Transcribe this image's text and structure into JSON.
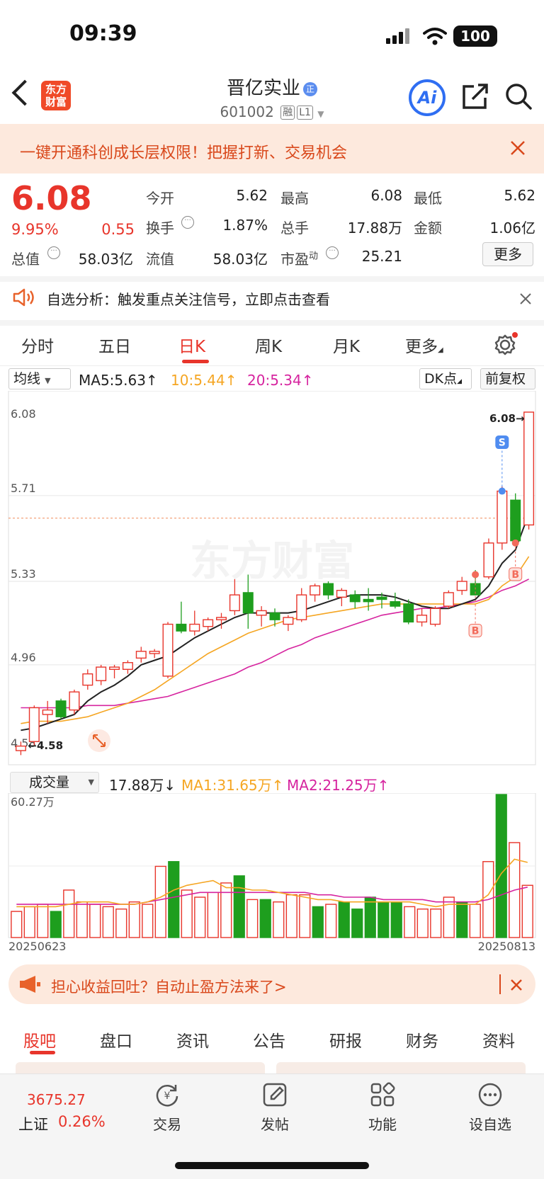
{
  "status_bar": {
    "time": "09:39",
    "battery": "100"
  },
  "header": {
    "logo": "东方财富",
    "title": "晋亿实业",
    "title_badge": "正",
    "code": "601002",
    "tags": [
      "融",
      "L1"
    ]
  },
  "banner": {
    "text": "一键开通科创成长层权限！把握打新、交易机会"
  },
  "quote": {
    "price": "6.08",
    "change_pct": "9.95%",
    "change": "0.55",
    "fields": [
      {
        "label": "今开",
        "value": "5.62",
        "red": true
      },
      {
        "label": "最高",
        "value": "6.08",
        "red": true
      },
      {
        "label": "最低",
        "value": "5.62",
        "red": true
      },
      {
        "label": "换手",
        "value": "1.87%"
      },
      {
        "label": "总手",
        "value": "17.88万"
      },
      {
        "label": "金额",
        "value": "1.06亿"
      },
      {
        "label": "总值",
        "value": "58.03亿"
      },
      {
        "label": "流值",
        "value": "58.03亿"
      },
      {
        "label": "市盈",
        "sup": "动",
        "value": "25.21"
      }
    ],
    "more": "更多"
  },
  "notice": {
    "text": "自选分析：触发重点关注信号，立即点击查看"
  },
  "chart_tabs": [
    "分时",
    "五日",
    "日K",
    "周K",
    "月K",
    "更多"
  ],
  "active_chart_tab": "日K",
  "kline_toolbar": {
    "indicator": "均线",
    "ma5": "MA5:5.63↑",
    "ma10": "10:5.44↑",
    "ma20": "20:5.34↑",
    "dk": "DK点",
    "adjust": "前复权"
  },
  "volume_toolbar": {
    "indicator": "成交量",
    "vol": "17.88万↓",
    "ma1": "MA1:31.65万↑",
    "ma2": "MA2:21.25万↑"
  },
  "colors": {
    "up": "#e8352b",
    "down": "#1e9e1e",
    "ma5": "#222222",
    "ma10": "#f5a623",
    "ma20": "#d6249f"
  },
  "chart_data": {
    "type": "candlestick",
    "price_axis_labels": [
      "6.08",
      "5.71",
      "5.33",
      "4.96",
      "4.58"
    ],
    "ylim": [
      4.58,
      6.08
    ],
    "high_label": "6.08→",
    "low_label": "←4.58",
    "signals": [
      "S",
      "B",
      "B"
    ],
    "date_start": "20250623",
    "date_end": "20250813",
    "volume_max_label": "60.27万",
    "volume_ylim": [
      0,
      60.27
    ],
    "ohlc": [
      [
        4.58,
        4.62,
        4.56,
        4.6
      ],
      [
        4.62,
        4.78,
        4.6,
        4.77
      ],
      [
        4.74,
        4.8,
        4.7,
        4.76
      ],
      [
        4.8,
        4.81,
        4.72,
        4.73
      ],
      [
        4.76,
        4.85,
        4.74,
        4.84
      ],
      [
        4.87,
        4.94,
        4.85,
        4.92
      ],
      [
        4.89,
        4.96,
        4.87,
        4.95
      ],
      [
        4.94,
        4.96,
        4.9,
        4.95
      ],
      [
        4.94,
        4.98,
        4.92,
        4.97
      ],
      [
        4.99,
        5.04,
        4.97,
        5.02
      ],
      [
        5.01,
        5.03,
        4.99,
        5.02
      ],
      [
        4.91,
        5.15,
        4.9,
        5.14
      ],
      [
        5.14,
        5.24,
        5.1,
        5.11
      ],
      [
        5.11,
        5.2,
        5.09,
        5.14
      ],
      [
        5.13,
        5.17,
        5.11,
        5.16
      ],
      [
        5.16,
        5.19,
        5.12,
        5.17
      ],
      [
        5.2,
        5.34,
        5.18,
        5.27
      ],
      [
        5.28,
        5.36,
        5.12,
        5.19
      ],
      [
        5.18,
        5.22,
        5.13,
        5.2
      ],
      [
        5.19,
        5.21,
        5.13,
        5.16
      ],
      [
        5.14,
        5.18,
        5.11,
        5.17
      ],
      [
        5.16,
        5.3,
        5.15,
        5.27
      ],
      [
        5.27,
        5.32,
        5.24,
        5.31
      ],
      [
        5.32,
        5.33,
        5.25,
        5.27
      ],
      [
        5.26,
        5.3,
        5.22,
        5.29
      ],
      [
        5.27,
        5.29,
        5.21,
        5.24
      ],
      [
        5.25,
        5.3,
        5.2,
        5.24
      ],
      [
        5.26,
        5.28,
        5.21,
        5.25
      ],
      [
        5.24,
        5.28,
        5.21,
        5.22
      ],
      [
        5.23,
        5.25,
        5.14,
        5.15
      ],
      [
        5.15,
        5.21,
        5.13,
        5.18
      ],
      [
        5.14,
        5.22,
        5.13,
        5.21
      ],
      [
        5.22,
        5.29,
        5.21,
        5.28
      ],
      [
        5.29,
        5.35,
        5.27,
        5.33
      ],
      [
        5.32,
        5.38,
        5.27,
        5.27
      ],
      [
        5.35,
        5.52,
        5.34,
        5.5
      ],
      [
        5.5,
        5.75,
        5.47,
        5.73
      ],
      [
        5.69,
        5.72,
        5.51,
        5.51
      ],
      [
        5.58,
        6.08,
        5.56,
        6.08
      ]
    ],
    "ma5": [
      4.67,
      4.68,
      4.7,
      4.72,
      4.74,
      4.8,
      4.84,
      4.87,
      4.91,
      4.96,
      4.98,
      5.0,
      5.04,
      5.08,
      5.11,
      5.14,
      5.17,
      5.19,
      5.19,
      5.19,
      5.19,
      5.2,
      5.22,
      5.24,
      5.26,
      5.27,
      5.27,
      5.27,
      5.26,
      5.24,
      5.22,
      5.21,
      5.21,
      5.23,
      5.25,
      5.31,
      5.41,
      5.47,
      5.63
    ],
    "ma10": [
      4.7,
      4.71,
      4.71,
      4.71,
      4.72,
      4.73,
      4.75,
      4.77,
      4.79,
      4.82,
      4.85,
      4.89,
      4.93,
      4.97,
      5.01,
      5.04,
      5.07,
      5.1,
      5.12,
      5.14,
      5.16,
      5.17,
      5.18,
      5.19,
      5.2,
      5.21,
      5.22,
      5.23,
      5.23,
      5.23,
      5.23,
      5.23,
      5.23,
      5.23,
      5.23,
      5.25,
      5.31,
      5.35,
      5.44
    ],
    "ma20": [
      4.77,
      4.77,
      4.77,
      4.77,
      4.77,
      4.78,
      4.78,
      4.78,
      4.79,
      4.8,
      4.81,
      4.82,
      4.84,
      4.86,
      4.88,
      4.9,
      4.92,
      4.95,
      4.97,
      5.0,
      5.03,
      5.05,
      5.08,
      5.1,
      5.12,
      5.14,
      5.16,
      5.18,
      5.19,
      5.2,
      5.21,
      5.21,
      5.22,
      5.23,
      5.24,
      5.26,
      5.29,
      5.31,
      5.34
    ],
    "volume": [
      11,
      13,
      14,
      11,
      20,
      15,
      14,
      13,
      12,
      15,
      14,
      30,
      32,
      20,
      17,
      19,
      23,
      26,
      16,
      16,
      15,
      18,
      18,
      13,
      14,
      15,
      12,
      17,
      15,
      15,
      13,
      12,
      12,
      17,
      15,
      14,
      32,
      60.27,
      40,
      22
    ],
    "vol_ma1": [
      13,
      13,
      13,
      13,
      14,
      15,
      15,
      15,
      14,
      14,
      15,
      17,
      20,
      22,
      23,
      24,
      21,
      21,
      20,
      20,
      19,
      18,
      17,
      16,
      16,
      15,
      15,
      15,
      15,
      15,
      15,
      14,
      13,
      14,
      14,
      14,
      18,
      27,
      33,
      31.65
    ],
    "vol_ma2": [
      14,
      14,
      14,
      14,
      14,
      14,
      14,
      14,
      14,
      14,
      15,
      16,
      17,
      18,
      19,
      19,
      19,
      19,
      19,
      19,
      19,
      19,
      19,
      18,
      18,
      17,
      17,
      17,
      16,
      16,
      16,
      16,
      15,
      15,
      15,
      15,
      16,
      18,
      20,
      21.25
    ]
  },
  "promo": {
    "text": "担心收益回吐？自动止盈方法来了>"
  },
  "bottom_tabs": [
    "股吧",
    "盘口",
    "资讯",
    "公告",
    "研报",
    "财务",
    "资料"
  ],
  "active_bottom_tab": "股吧",
  "bottom_nav": {
    "index_value": "3675.27",
    "index_name": "上证",
    "index_change": "0.26%",
    "items": [
      "交易",
      "发帖",
      "功能",
      "设自选"
    ]
  }
}
